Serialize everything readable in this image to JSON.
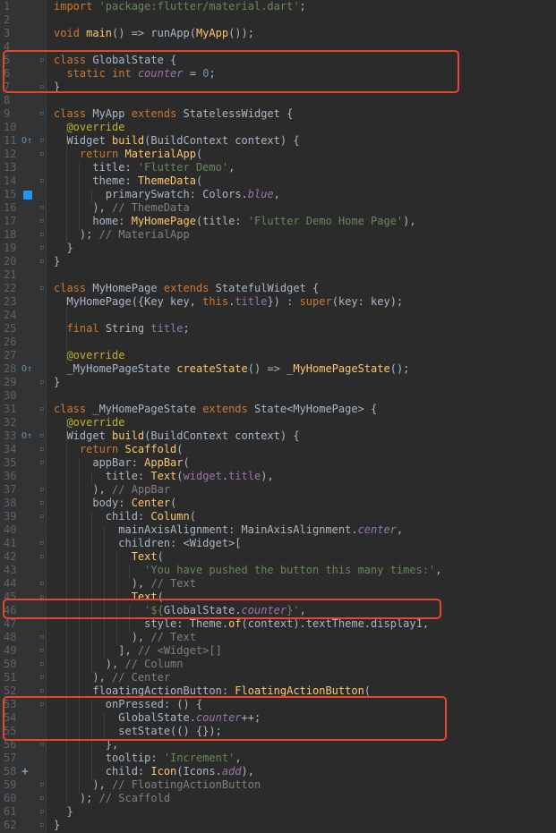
{
  "editor": {
    "lines": [
      {
        "n": "1",
        "segs": [
          [
            "kw",
            "import "
          ],
          [
            "str",
            "'package:flutter/material.dart'"
          ],
          [
            "",
            "; "
          ]
        ]
      },
      {
        "n": "2",
        "segs": []
      },
      {
        "n": "3",
        "segs": [
          [
            "kw",
            "void "
          ],
          [
            "fn",
            "main"
          ],
          [
            "",
            "() => runApp("
          ],
          [
            "fn",
            "MyApp"
          ],
          [
            "",
            "());"
          ]
        ]
      },
      {
        "n": "4",
        "segs": []
      },
      {
        "n": "5",
        "segs": [
          [
            "kw",
            "class "
          ],
          [
            "",
            "GlobalState {"
          ]
        ]
      },
      {
        "n": "6",
        "segs": [
          [
            "",
            "  "
          ],
          [
            "kw",
            "static int "
          ],
          [
            "fldi",
            "counter"
          ],
          [
            "",
            " = "
          ],
          [
            "num",
            "0"
          ],
          [
            "",
            ";"
          ]
        ]
      },
      {
        "n": "7",
        "segs": [
          [
            "",
            "}"
          ]
        ]
      },
      {
        "n": "8",
        "segs": []
      },
      {
        "n": "9",
        "segs": [
          [
            "kw",
            "class "
          ],
          [
            "",
            "MyApp "
          ],
          [
            "kw",
            "extends "
          ],
          [
            "",
            "StatelessWidget {"
          ]
        ]
      },
      {
        "n": "10",
        "segs": [
          [
            "",
            "  "
          ],
          [
            "ann",
            "@override"
          ]
        ]
      },
      {
        "n": "11",
        "segs": [
          [
            "",
            "  Widget "
          ],
          [
            "fn",
            "build"
          ],
          [
            "",
            "(BuildContext context) {"
          ]
        ]
      },
      {
        "n": "12",
        "segs": [
          [
            "",
            "    "
          ],
          [
            "kw",
            "return "
          ],
          [
            "fn",
            "MaterialApp"
          ],
          [
            "",
            "("
          ]
        ]
      },
      {
        "n": "13",
        "segs": [
          [
            "",
            "      title: "
          ],
          [
            "str",
            "'Flutter Demo'"
          ],
          [
            "",
            ","
          ]
        ]
      },
      {
        "n": "14",
        "segs": [
          [
            "",
            "      theme: "
          ],
          [
            "fn",
            "ThemeData"
          ],
          [
            "",
            "("
          ]
        ]
      },
      {
        "n": "15",
        "segs": [
          [
            "",
            "        primarySwatch: Colors."
          ],
          [
            "fldi",
            "blue"
          ],
          [
            "",
            ","
          ]
        ]
      },
      {
        "n": "16",
        "segs": [
          [
            "",
            "      ), "
          ],
          [
            "cm",
            "// ThemeData"
          ]
        ]
      },
      {
        "n": "17",
        "segs": [
          [
            "",
            "      home: "
          ],
          [
            "fn",
            "MyHomePage"
          ],
          [
            "",
            "(title: "
          ],
          [
            "str",
            "'Flutter Demo Home Page'"
          ],
          [
            "",
            "),"
          ]
        ]
      },
      {
        "n": "18",
        "segs": [
          [
            "",
            "    ); "
          ],
          [
            "cm",
            "// MaterialApp"
          ]
        ]
      },
      {
        "n": "19",
        "segs": [
          [
            "",
            "  }"
          ]
        ]
      },
      {
        "n": "20",
        "segs": [
          [
            "",
            "}"
          ]
        ]
      },
      {
        "n": "21",
        "segs": []
      },
      {
        "n": "22",
        "segs": [
          [
            "kw",
            "class "
          ],
          [
            "",
            "MyHomePage "
          ],
          [
            "kw",
            "extends "
          ],
          [
            "",
            "StatefulWidget {"
          ]
        ]
      },
      {
        "n": "23",
        "segs": [
          [
            "",
            "  MyHomePage({Key key, "
          ],
          [
            "kw",
            "this"
          ],
          [
            "",
            "."
          ],
          [
            "fld",
            "title"
          ],
          [
            "",
            "}) : "
          ],
          [
            "kw",
            "super"
          ],
          [
            "",
            "(key: key);"
          ]
        ]
      },
      {
        "n": "24",
        "segs": []
      },
      {
        "n": "25",
        "segs": [
          [
            "",
            "  "
          ],
          [
            "kw",
            "final "
          ],
          [
            "",
            "String "
          ],
          [
            "fld",
            "title"
          ],
          [
            "",
            ";"
          ]
        ]
      },
      {
        "n": "26",
        "segs": []
      },
      {
        "n": "27",
        "segs": [
          [
            "",
            "  "
          ],
          [
            "ann",
            "@override"
          ]
        ]
      },
      {
        "n": "28",
        "segs": [
          [
            "",
            "  _MyHomePageState "
          ],
          [
            "fn",
            "createState"
          ],
          [
            "",
            "() => "
          ],
          [
            "fn",
            "_MyHomePageState"
          ],
          [
            "",
            "();"
          ]
        ]
      },
      {
        "n": "29",
        "segs": [
          [
            "",
            "}"
          ]
        ]
      },
      {
        "n": "30",
        "segs": []
      },
      {
        "n": "31",
        "segs": [
          [
            "kw",
            "class "
          ],
          [
            "",
            "_MyHomePageState "
          ],
          [
            "kw",
            "extends "
          ],
          [
            "",
            "State<MyHomePage> {"
          ]
        ]
      },
      {
        "n": "32",
        "segs": [
          [
            "",
            "  "
          ],
          [
            "ann",
            "@override"
          ]
        ]
      },
      {
        "n": "33",
        "segs": [
          [
            "",
            "  Widget "
          ],
          [
            "fn",
            "build"
          ],
          [
            "",
            "(BuildContext context) {"
          ]
        ]
      },
      {
        "n": "34",
        "segs": [
          [
            "",
            "    "
          ],
          [
            "kw",
            "return "
          ],
          [
            "fn",
            "Scaffold"
          ],
          [
            "",
            "("
          ]
        ]
      },
      {
        "n": "35",
        "segs": [
          [
            "",
            "      appBar: "
          ],
          [
            "fn",
            "AppBar"
          ],
          [
            "",
            "("
          ]
        ]
      },
      {
        "n": "36",
        "segs": [
          [
            "",
            "        title: "
          ],
          [
            "fn",
            "Text"
          ],
          [
            "",
            "("
          ],
          [
            "fld",
            "widget"
          ],
          [
            "",
            "."
          ],
          [
            "fld",
            "title"
          ],
          [
            "",
            "),"
          ]
        ]
      },
      {
        "n": "37",
        "segs": [
          [
            "",
            "      ), "
          ],
          [
            "cm",
            "// AppBar"
          ]
        ]
      },
      {
        "n": "38",
        "segs": [
          [
            "",
            "      body: "
          ],
          [
            "fn",
            "Center"
          ],
          [
            "",
            "("
          ]
        ]
      },
      {
        "n": "39",
        "segs": [
          [
            "",
            "        child: "
          ],
          [
            "fn",
            "Column"
          ],
          [
            "",
            "("
          ]
        ]
      },
      {
        "n": "40",
        "segs": [
          [
            "",
            "          mainAxisAlignment: MainAxisAlignment."
          ],
          [
            "fldi",
            "center"
          ],
          [
            "",
            ","
          ]
        ]
      },
      {
        "n": "41",
        "segs": [
          [
            "",
            "          children: <Widget>["
          ]
        ]
      },
      {
        "n": "42",
        "segs": [
          [
            "",
            "            "
          ],
          [
            "fn",
            "Text"
          ],
          [
            "",
            "("
          ]
        ]
      },
      {
        "n": "43",
        "segs": [
          [
            "",
            "              "
          ],
          [
            "str",
            "'You have pushed the button this many times:'"
          ],
          [
            "",
            ","
          ]
        ]
      },
      {
        "n": "44",
        "segs": [
          [
            "",
            "            ), "
          ],
          [
            "cm",
            "// Text"
          ]
        ]
      },
      {
        "n": "45",
        "segs": [
          [
            "",
            "            "
          ],
          [
            "fn",
            "Text"
          ],
          [
            "",
            "("
          ]
        ]
      },
      {
        "n": "46",
        "segs": [
          [
            "",
            "              "
          ],
          [
            "str",
            "'${"
          ],
          [
            "",
            "GlobalState."
          ],
          [
            "fldi",
            "counter"
          ],
          [
            "str",
            "}'"
          ],
          [
            "",
            ","
          ]
        ]
      },
      {
        "n": "47",
        "segs": [
          [
            "",
            "              style: Theme."
          ],
          [
            "fn",
            "of"
          ],
          [
            "",
            "(context).textTheme.display1,"
          ]
        ]
      },
      {
        "n": "48",
        "segs": [
          [
            "",
            "            ), "
          ],
          [
            "cm",
            "// Text"
          ]
        ]
      },
      {
        "n": "49",
        "segs": [
          [
            "",
            "          ], "
          ],
          [
            "cm",
            "// <Widget>[]"
          ]
        ]
      },
      {
        "n": "50",
        "segs": [
          [
            "",
            "        ), "
          ],
          [
            "cm",
            "// Column"
          ]
        ]
      },
      {
        "n": "51",
        "segs": [
          [
            "",
            "      ), "
          ],
          [
            "cm",
            "// Center"
          ]
        ]
      },
      {
        "n": "52",
        "segs": [
          [
            "",
            "      floatingActionButton: "
          ],
          [
            "fn",
            "FloatingActionButton"
          ],
          [
            "",
            "("
          ]
        ]
      },
      {
        "n": "53",
        "segs": [
          [
            "",
            "        onPressed: () {"
          ]
        ]
      },
      {
        "n": "54",
        "segs": [
          [
            "",
            "          GlobalState."
          ],
          [
            "fldi",
            "counter"
          ],
          [
            "",
            "++;"
          ]
        ]
      },
      {
        "n": "55",
        "segs": [
          [
            "",
            "          setState(() {});"
          ]
        ]
      },
      {
        "n": "56",
        "segs": [
          [
            "",
            "        },"
          ]
        ]
      },
      {
        "n": "57",
        "segs": [
          [
            "",
            "        tooltip: "
          ],
          [
            "str",
            "'Increment'"
          ],
          [
            "",
            ","
          ]
        ]
      },
      {
        "n": "58",
        "segs": [
          [
            "",
            "        child: "
          ],
          [
            "fn",
            "Icon"
          ],
          [
            "",
            "(Icons."
          ],
          [
            "fldi",
            "add"
          ],
          [
            "",
            "),"
          ]
        ]
      },
      {
        "n": "59",
        "segs": [
          [
            "",
            "      ), "
          ],
          [
            "cm",
            "// FloatingActionButton"
          ]
        ]
      },
      {
        "n": "60",
        "segs": [
          [
            "",
            "    ); "
          ],
          [
            "cm",
            "// Scaffold"
          ]
        ]
      },
      {
        "n": "61",
        "segs": [
          [
            "",
            "  }"
          ]
        ]
      },
      {
        "n": "62",
        "segs": [
          [
            "",
            "}"
          ]
        ]
      }
    ],
    "gutter_icons": {
      "11": "override-up-arrow-icon",
      "15": "color-swatch-icon",
      "28": "override-up-arrow-icon",
      "33": "override-up-arrow-icon",
      "58": "plus-material-icon"
    },
    "highlight_boxes": [
      {
        "label": "global-state-class",
        "lines": "5-7"
      },
      {
        "label": "counter-interpolation",
        "lines": "46"
      },
      {
        "label": "on-pressed-handler",
        "lines": "53-55"
      }
    ],
    "colors": {
      "highlight_box": "#e8452d",
      "swatch_blue": "#2196f3",
      "background": "#2b2b2b"
    }
  }
}
